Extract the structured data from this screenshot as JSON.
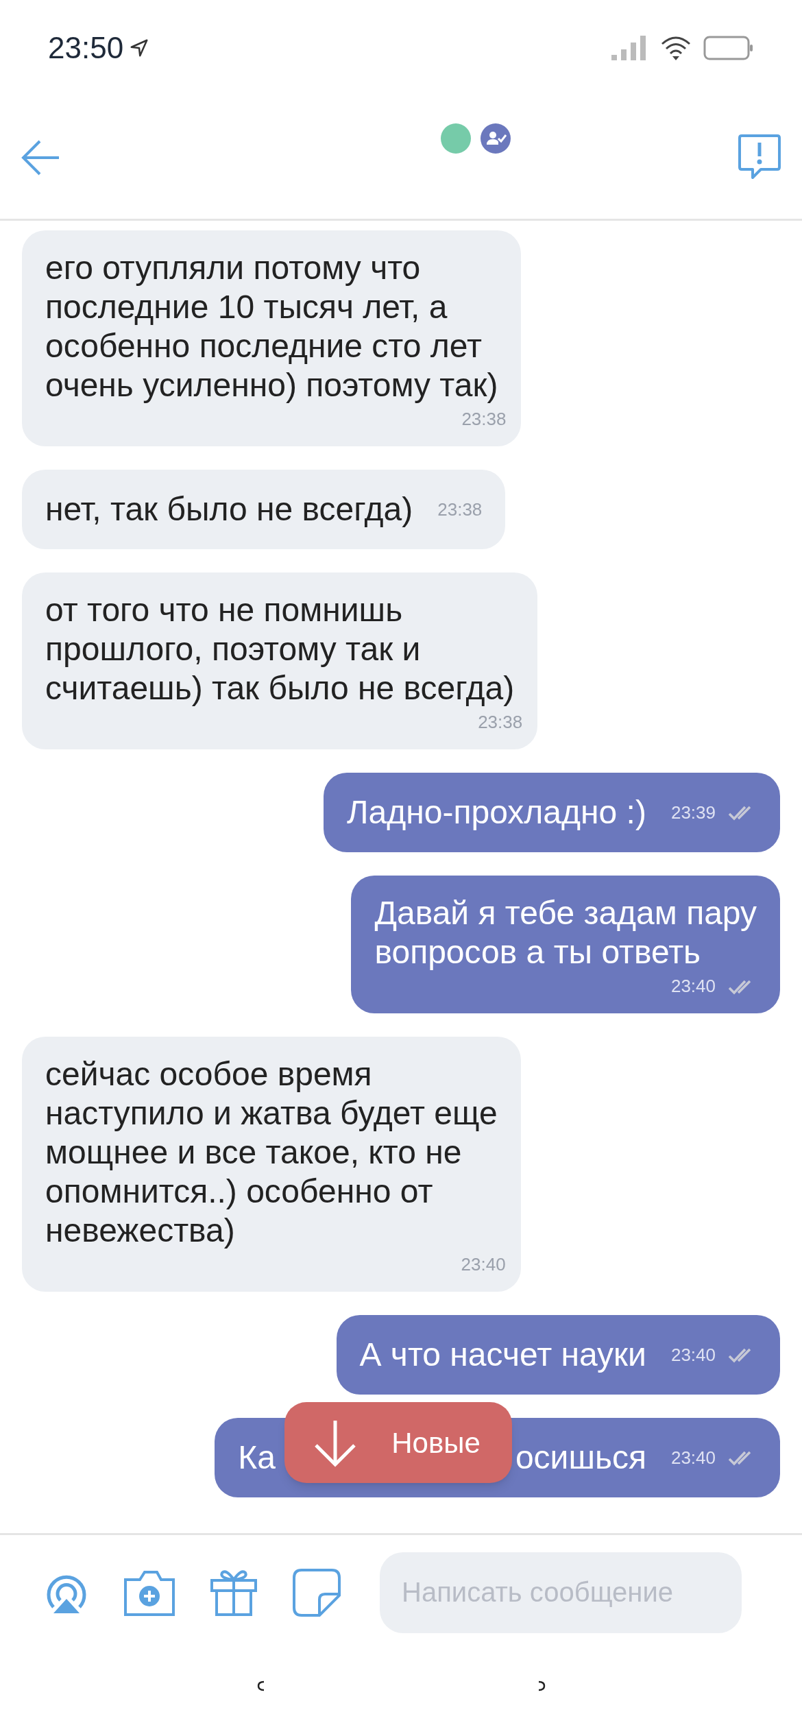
{
  "status_bar": {
    "time": "23:50"
  },
  "messages": [
    {
      "kind": "incoming",
      "text": "его отупляли потому что\nпоследние 10 тысяч лет, а\nособенно последние сто лет\nочень усиленно) поэтому так)",
      "time": "23:38"
    },
    {
      "kind": "incoming",
      "text": "нет, так было не всегда)",
      "time": "23:38"
    },
    {
      "kind": "incoming",
      "text": "от того что не помнишь\nпрошлого, поэтому так и\nсчитаешь) так было не всегда)",
      "time": "23:38"
    },
    {
      "kind": "outgoing",
      "text": "Ладно-прохладно :)",
      "time": "23:39",
      "read": true
    },
    {
      "kind": "outgoing",
      "text": "Давай я тебе задам пару\nвопросов а ты ответь",
      "time": "23:40",
      "read": true
    },
    {
      "kind": "incoming",
      "text": "сейчас особое время\nнаступило и жатва будет еще\nмощнее и все такое, кто не\nопомнится..) особенно от\nневежества)",
      "time": "23:40"
    },
    {
      "kind": "outgoing",
      "text": "А что насчет науки",
      "time": "23:40",
      "read": true
    },
    {
      "kind": "outgoing",
      "text_parts": [
        "Ка",
        "осишься"
      ],
      "time": "23:40",
      "read": true
    }
  ],
  "new_messages_button": {
    "label": "Новые"
  },
  "composer": {
    "placeholder": "Написать сообщение"
  }
}
